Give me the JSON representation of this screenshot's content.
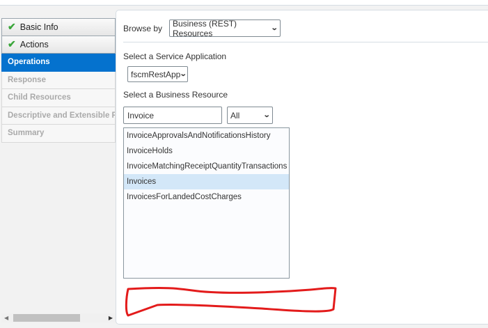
{
  "nav": {
    "items": [
      {
        "label": "Basic Info",
        "state": "done"
      },
      {
        "label": "Actions",
        "state": "done"
      },
      {
        "label": "Operations",
        "state": "active"
      },
      {
        "label": "Response",
        "state": "disabled"
      },
      {
        "label": "Child Resources",
        "state": "disabled"
      },
      {
        "label": "Descriptive and Extensible Flexfields",
        "state": "disabled"
      },
      {
        "label": "Summary",
        "state": "disabled"
      }
    ]
  },
  "form": {
    "browse_by_label": "Browse by",
    "browse_by_value": "Business (REST) Resources",
    "service_app_label": "Select a Service Application",
    "service_app_value": "fscmRestApp",
    "business_resource_label": "Select a Business Resource",
    "search_value": "Invoice",
    "filter_value": "All",
    "resources": [
      "InvoiceApprovalsAndNotificationsHistory",
      "InvoiceHolds",
      "InvoiceMatchingReceiptQuantityTransactions",
      "Invoices",
      "InvoicesForLandedCostCharges"
    ],
    "selected_resource": "Invoices"
  },
  "colors": {
    "accent": "#0572ce",
    "selected_row": "#d3e7f8",
    "annotation": "#e31b1b"
  }
}
